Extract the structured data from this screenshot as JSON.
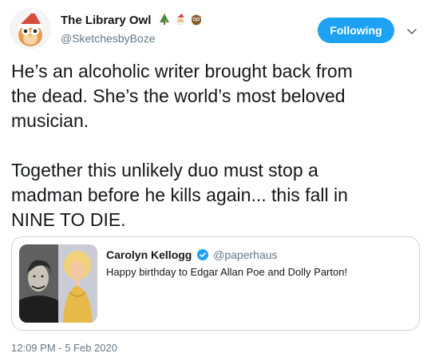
{
  "author": {
    "display_name": "The Library Owl",
    "handle": "@SketchesbyBoze",
    "emoji_icons": [
      "christmas-tree-icon",
      "santa-face-icon",
      "owl-icon"
    ]
  },
  "follow_button": {
    "label": "Following"
  },
  "menu": {
    "icon": "chevron-down-icon"
  },
  "tweet": {
    "text": "He’s an alcoholic writer brought back from\nthe dead. She’s the world’s most beloved\nmusician.\n\nTogether this unlikely duo must stop a\nmadman before he kills again... this fall in\nNINE TO DIE.",
    "timestamp": "12:09 PM - 5 Feb 2020"
  },
  "quoted_tweet": {
    "display_name": "Carolyn Kellogg",
    "handle": "@paperhaus",
    "verified_icon": "verified-badge-icon",
    "text": "Happy birthday to Edgar Allan Poe and Dolly Parton!"
  },
  "colors": {
    "accent": "#1da1f2",
    "secondary_text": "#657786",
    "border": "#ccd6dd"
  }
}
